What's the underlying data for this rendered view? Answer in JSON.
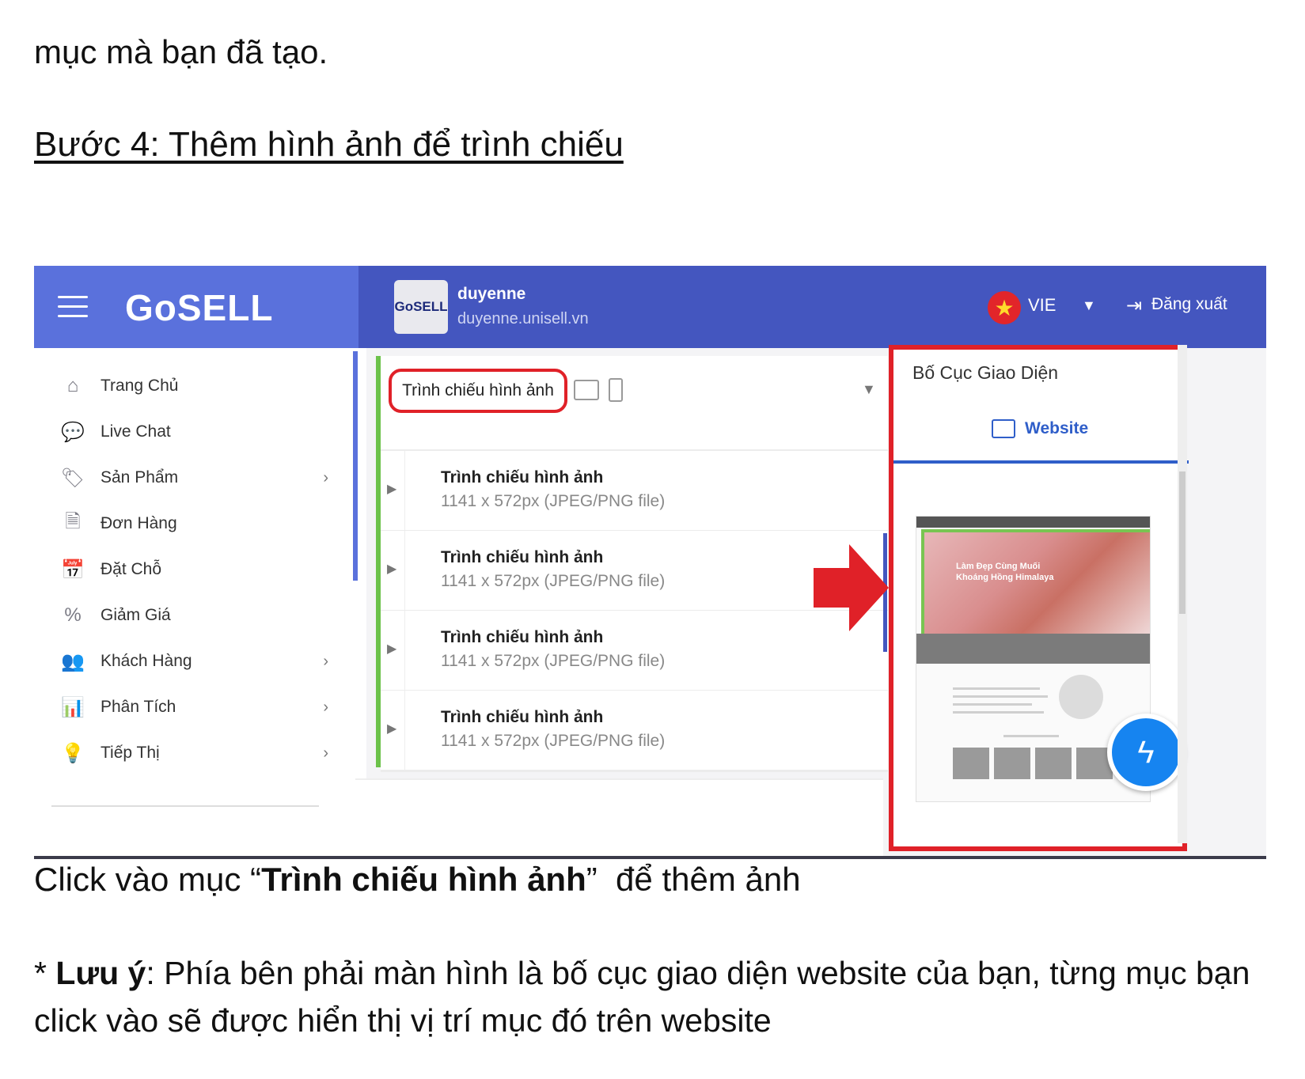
{
  "document": {
    "intro_line": "mục mà bạn đã tạo.",
    "step_heading": "Bước 4: Thêm hình ảnh để trình chiếu ",
    "caption_before": "Click vào mục “",
    "caption_bold": "Trình chiếu hình ảnh",
    "caption_after": "”  để thêm ảnh",
    "note_star": "* ",
    "note_bold": "Lưu ý",
    "note_text": ": Phía bên phải màn hình là bố cục giao diện website của bạn, từng mục bạn click vào sẽ được hiển thị vị trí mục đó trên website"
  },
  "topbar": {
    "logo_text": "GoSELL",
    "shop_avatar_text": "GoSELL",
    "shop_name": "duyenne",
    "shop_url": "duyenne.unisell.vn",
    "language": "VIE",
    "logout_label": "Đăng xuất"
  },
  "sidebar": {
    "items": [
      {
        "label": "Trang Chủ",
        "icon": "home-icon",
        "has_chevron": false
      },
      {
        "label": "Live Chat",
        "icon": "chat-icon",
        "has_chevron": false
      },
      {
        "label": "Sản Phẩm",
        "icon": "tag-icon",
        "has_chevron": true
      },
      {
        "label": "Đơn Hàng",
        "icon": "receipt-icon",
        "has_chevron": false
      },
      {
        "label": "Đặt Chỗ",
        "icon": "calendar-check-icon",
        "has_chevron": false
      },
      {
        "label": "Giảm Giá",
        "icon": "discount-icon",
        "has_chevron": false
      },
      {
        "label": "Khách Hàng",
        "icon": "users-icon",
        "has_chevron": true
      },
      {
        "label": "Phân Tích",
        "icon": "analytics-icon",
        "has_chevron": true
      },
      {
        "label": "Tiếp Thị",
        "icon": "lightbulb-icon",
        "has_chevron": true
      }
    ]
  },
  "editor": {
    "section_selected": "Trình chiếu hình ảnh",
    "slides": [
      {
        "title": "Trình chiếu hình ảnh",
        "spec": "1141 x 572px (JPEG/PNG file)"
      },
      {
        "title": "Trình chiếu hình ảnh",
        "spec": "1141 x 572px (JPEG/PNG file)"
      },
      {
        "title": "Trình chiếu hình ảnh",
        "spec": "1141 x 572px (JPEG/PNG file)"
      },
      {
        "title": "Trình chiếu hình ảnh",
        "spec": "1141 x 572px (JPEG/PNG file)"
      }
    ]
  },
  "layout_panel": {
    "title": "Bố Cục Giao Diện",
    "tab_label": "Website",
    "preview_hero_text": "Làm Đẹp Cùng Muối\nKhoáng Hồng Himalaya"
  },
  "colors": {
    "topbar_left": "#5a71dc",
    "topbar_right": "#4456bf",
    "highlight_red": "#e02128",
    "accent_green": "#6cc24a",
    "tab_blue": "#2f5ec9"
  }
}
